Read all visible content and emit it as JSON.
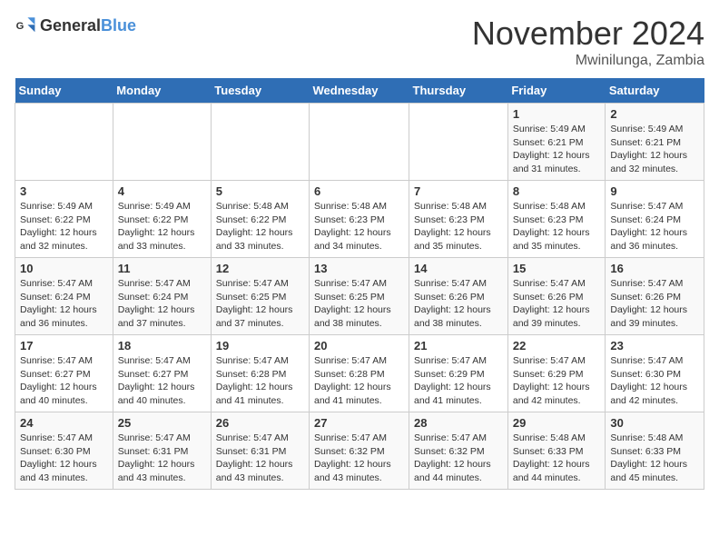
{
  "logo": {
    "text_general": "General",
    "text_blue": "Blue"
  },
  "title": "November 2024",
  "location": "Mwinilunga, Zambia",
  "days_of_week": [
    "Sunday",
    "Monday",
    "Tuesday",
    "Wednesday",
    "Thursday",
    "Friday",
    "Saturday"
  ],
  "weeks": [
    [
      {
        "day": "",
        "info": ""
      },
      {
        "day": "",
        "info": ""
      },
      {
        "day": "",
        "info": ""
      },
      {
        "day": "",
        "info": ""
      },
      {
        "day": "",
        "info": ""
      },
      {
        "day": "1",
        "info": "Sunrise: 5:49 AM\nSunset: 6:21 PM\nDaylight: 12 hours and 31 minutes."
      },
      {
        "day": "2",
        "info": "Sunrise: 5:49 AM\nSunset: 6:21 PM\nDaylight: 12 hours and 32 minutes."
      }
    ],
    [
      {
        "day": "3",
        "info": "Sunrise: 5:49 AM\nSunset: 6:22 PM\nDaylight: 12 hours and 32 minutes."
      },
      {
        "day": "4",
        "info": "Sunrise: 5:49 AM\nSunset: 6:22 PM\nDaylight: 12 hours and 33 minutes."
      },
      {
        "day": "5",
        "info": "Sunrise: 5:48 AM\nSunset: 6:22 PM\nDaylight: 12 hours and 33 minutes."
      },
      {
        "day": "6",
        "info": "Sunrise: 5:48 AM\nSunset: 6:23 PM\nDaylight: 12 hours and 34 minutes."
      },
      {
        "day": "7",
        "info": "Sunrise: 5:48 AM\nSunset: 6:23 PM\nDaylight: 12 hours and 35 minutes."
      },
      {
        "day": "8",
        "info": "Sunrise: 5:48 AM\nSunset: 6:23 PM\nDaylight: 12 hours and 35 minutes."
      },
      {
        "day": "9",
        "info": "Sunrise: 5:47 AM\nSunset: 6:24 PM\nDaylight: 12 hours and 36 minutes."
      }
    ],
    [
      {
        "day": "10",
        "info": "Sunrise: 5:47 AM\nSunset: 6:24 PM\nDaylight: 12 hours and 36 minutes."
      },
      {
        "day": "11",
        "info": "Sunrise: 5:47 AM\nSunset: 6:24 PM\nDaylight: 12 hours and 37 minutes."
      },
      {
        "day": "12",
        "info": "Sunrise: 5:47 AM\nSunset: 6:25 PM\nDaylight: 12 hours and 37 minutes."
      },
      {
        "day": "13",
        "info": "Sunrise: 5:47 AM\nSunset: 6:25 PM\nDaylight: 12 hours and 38 minutes."
      },
      {
        "day": "14",
        "info": "Sunrise: 5:47 AM\nSunset: 6:26 PM\nDaylight: 12 hours and 38 minutes."
      },
      {
        "day": "15",
        "info": "Sunrise: 5:47 AM\nSunset: 6:26 PM\nDaylight: 12 hours and 39 minutes."
      },
      {
        "day": "16",
        "info": "Sunrise: 5:47 AM\nSunset: 6:26 PM\nDaylight: 12 hours and 39 minutes."
      }
    ],
    [
      {
        "day": "17",
        "info": "Sunrise: 5:47 AM\nSunset: 6:27 PM\nDaylight: 12 hours and 40 minutes."
      },
      {
        "day": "18",
        "info": "Sunrise: 5:47 AM\nSunset: 6:27 PM\nDaylight: 12 hours and 40 minutes."
      },
      {
        "day": "19",
        "info": "Sunrise: 5:47 AM\nSunset: 6:28 PM\nDaylight: 12 hours and 41 minutes."
      },
      {
        "day": "20",
        "info": "Sunrise: 5:47 AM\nSunset: 6:28 PM\nDaylight: 12 hours and 41 minutes."
      },
      {
        "day": "21",
        "info": "Sunrise: 5:47 AM\nSunset: 6:29 PM\nDaylight: 12 hours and 41 minutes."
      },
      {
        "day": "22",
        "info": "Sunrise: 5:47 AM\nSunset: 6:29 PM\nDaylight: 12 hours and 42 minutes."
      },
      {
        "day": "23",
        "info": "Sunrise: 5:47 AM\nSunset: 6:30 PM\nDaylight: 12 hours and 42 minutes."
      }
    ],
    [
      {
        "day": "24",
        "info": "Sunrise: 5:47 AM\nSunset: 6:30 PM\nDaylight: 12 hours and 43 minutes."
      },
      {
        "day": "25",
        "info": "Sunrise: 5:47 AM\nSunset: 6:31 PM\nDaylight: 12 hours and 43 minutes."
      },
      {
        "day": "26",
        "info": "Sunrise: 5:47 AM\nSunset: 6:31 PM\nDaylight: 12 hours and 43 minutes."
      },
      {
        "day": "27",
        "info": "Sunrise: 5:47 AM\nSunset: 6:32 PM\nDaylight: 12 hours and 43 minutes."
      },
      {
        "day": "28",
        "info": "Sunrise: 5:47 AM\nSunset: 6:32 PM\nDaylight: 12 hours and 44 minutes."
      },
      {
        "day": "29",
        "info": "Sunrise: 5:48 AM\nSunset: 6:33 PM\nDaylight: 12 hours and 44 minutes."
      },
      {
        "day": "30",
        "info": "Sunrise: 5:48 AM\nSunset: 6:33 PM\nDaylight: 12 hours and 45 minutes."
      }
    ]
  ]
}
